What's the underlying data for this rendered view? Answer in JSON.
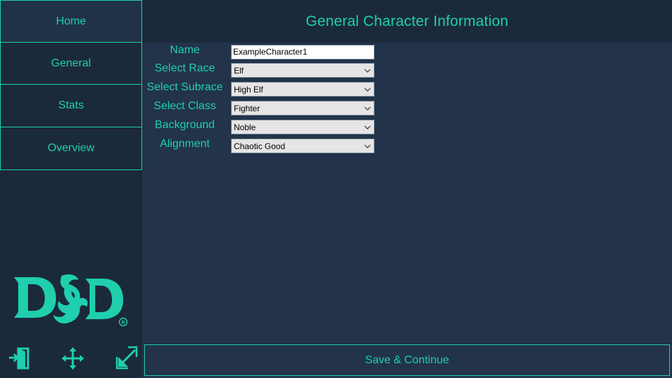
{
  "sidebar": {
    "nav": [
      {
        "label": "Home"
      },
      {
        "label": "General"
      },
      {
        "label": "Stats"
      },
      {
        "label": "Overview"
      }
    ],
    "logo_text": "D&D",
    "logo_mark": "®",
    "tools": [
      {
        "icon": "exit-icon"
      },
      {
        "icon": "move-icon"
      },
      {
        "icon": "minimize-icon"
      }
    ]
  },
  "header": {
    "title": "General Character Information"
  },
  "form": {
    "name": {
      "label": "Name",
      "value": "ExampleCharacter1"
    },
    "race": {
      "label": "Select Race",
      "value": "Elf"
    },
    "subrace": {
      "label": "Select Subrace",
      "value": "High Elf"
    },
    "class": {
      "label": "Select Class",
      "value": "Fighter"
    },
    "background": {
      "label": "Background",
      "value": "Noble"
    },
    "alignment": {
      "label": "Alignment",
      "value": "Chaotic Good"
    }
  },
  "footer": {
    "save_label": "Save & Continue"
  },
  "colors": {
    "accent": "#1fcfae",
    "sidebar_bg": "#1b2a3b",
    "content_bg": "#22334a"
  }
}
